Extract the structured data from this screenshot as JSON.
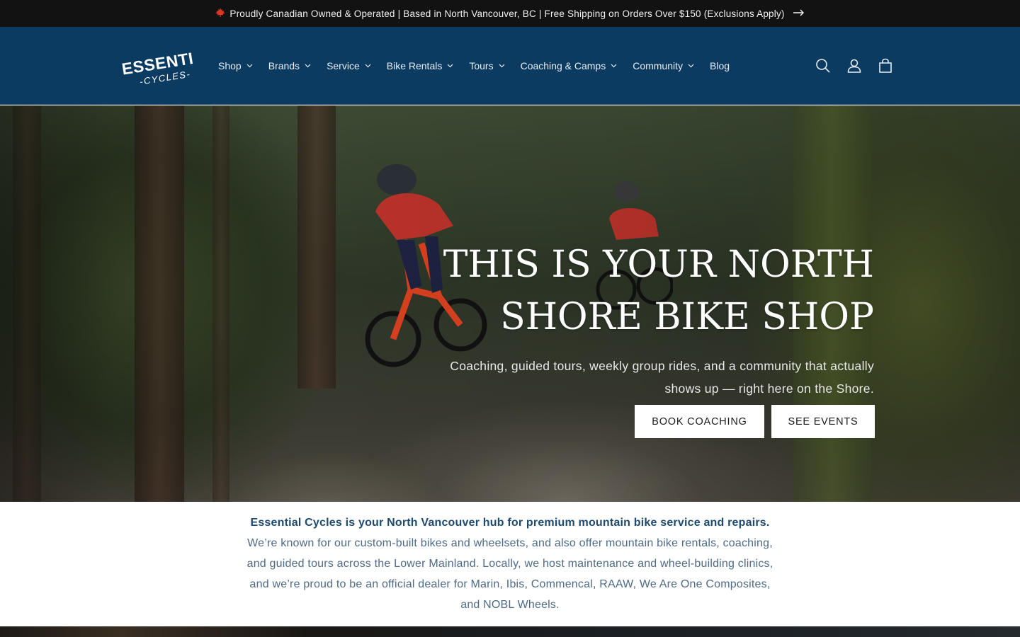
{
  "announcement": {
    "text": "Proudly Canadian Owned & Operated | Based in North Vancouver, BC | Free Shipping on Orders Over $150 (Exclusions Apply)",
    "icon": "maple-leaf-icon",
    "arrow_icon": "arrow-right-icon"
  },
  "header": {
    "logo_line1": "ESSENTIAL",
    "logo_line2": "-CYCLES-",
    "nav": [
      {
        "label": "Shop"
      },
      {
        "label": "Brands"
      },
      {
        "label": "Service"
      },
      {
        "label": "Bike Rentals"
      },
      {
        "label": "Tours"
      },
      {
        "label": "Coaching & Camps"
      },
      {
        "label": "Community"
      },
      {
        "label": "Blog"
      }
    ],
    "icons": [
      "search-icon",
      "account-icon",
      "cart-icon"
    ]
  },
  "hero": {
    "title_line1": "THIS IS YOUR NORTH",
    "title_line2": "SHORE BIKE SHOP",
    "subtitle_line1": "Coaching, guided tours, weekly group rides, and a community that actually",
    "subtitle_line2": "shows up — right here on the Shore.",
    "primary_button": "BOOK COACHING",
    "secondary_button": "SEE EVENTS"
  },
  "intro": {
    "bold": "Essential Cycles is your North Vancouver hub for premium mountain bike service and repairs.",
    "text": " We’re known for our custom-built bikes and wheelsets, and also offer mountain bike rentals, coaching, and guided tours across the Lower Mainland. Locally, we host maintenance and wheel-building clinics, and we’re proud to be an official dealer for Marin, Ibis, Commencal, RAAW, We Are One Composites, and NOBL Wheels."
  },
  "colors": {
    "announcement_bg": "#121212",
    "header_bg": "#0c3b62",
    "intro_text": "#4e6a86",
    "intro_bold": "#1f4a70"
  }
}
